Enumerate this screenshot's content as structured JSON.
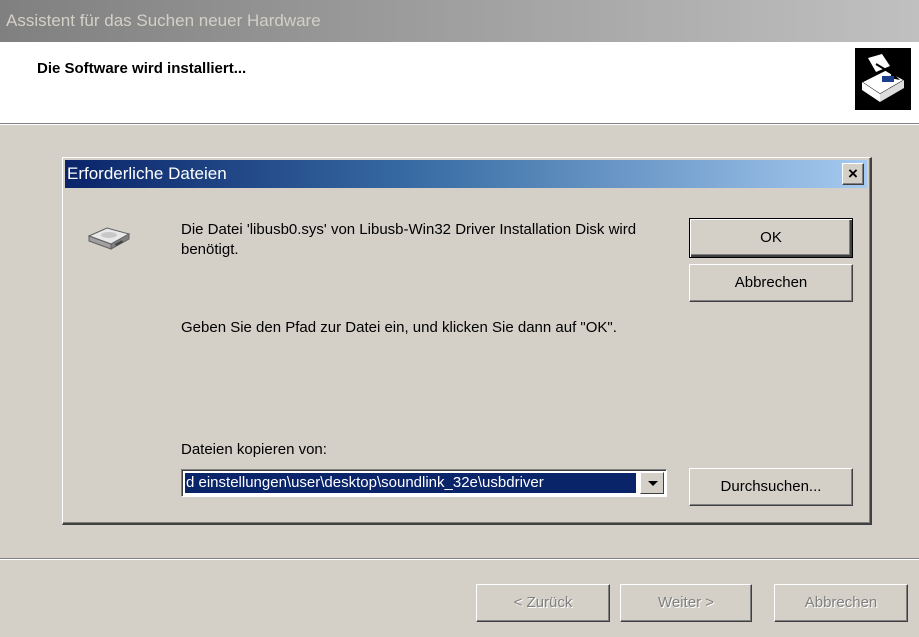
{
  "window": {
    "title": "Assistent für das Suchen neuer Hardware"
  },
  "wizard": {
    "heading": "Die Software wird installiert...",
    "icon": "hardware-wizard-icon",
    "back_label": "< Zurück",
    "next_label": "Weiter >",
    "cancel_label": "Abbrechen"
  },
  "dialog": {
    "title": "Erforderliche Dateien",
    "close_label": "×",
    "icon": "disk-drive-icon",
    "message": "Die Datei 'libusb0.sys' von Libusb-Win32 Driver Installation Disk wird benötigt.",
    "instruction": "Geben Sie den Pfad zur Datei ein, und klicken Sie dann auf \"OK\".",
    "copy_from_label": "Dateien kopieren von:",
    "copy_from_value": "d einstellungen\\user\\desktop\\soundlink_32e\\usbdriver",
    "ok_label": "OK",
    "cancel_label": "Abbrechen",
    "browse_label": "Durchsuchen..."
  },
  "colors": {
    "face": "#d4d0c8",
    "active_title": "#0a246a",
    "inactive_title": "#808080",
    "selection": "#0a246a"
  }
}
